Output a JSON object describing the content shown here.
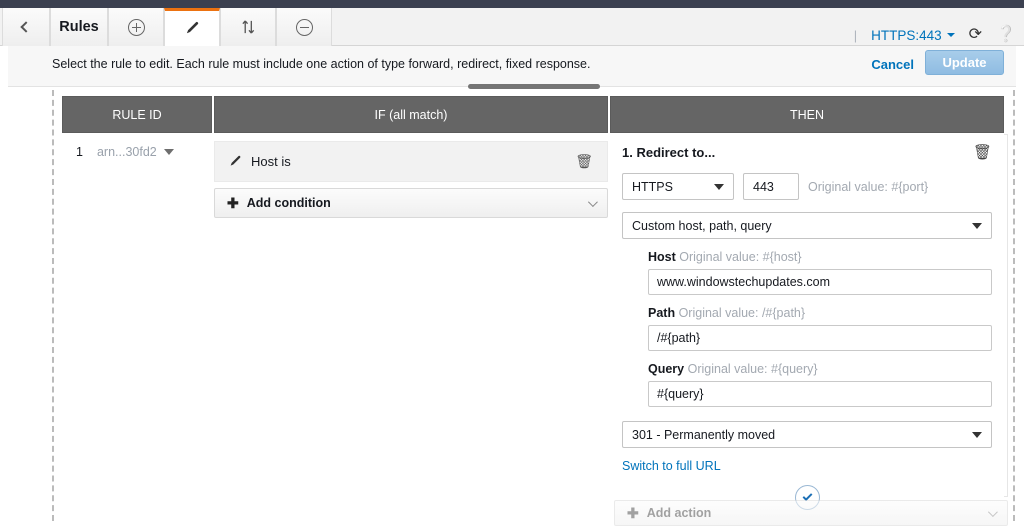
{
  "toolbar": {
    "back_icon": "chevron-left-icon",
    "title": "Rules",
    "add_icon": "plus-circle-icon",
    "edit_icon": "pencil-icon",
    "reorder_icon": "sort-updown-icon",
    "delete_icon": "minus-circle-icon",
    "separator": "|",
    "listener": "HTTPS:443",
    "refresh_icon": "refresh-icon",
    "help_icon": "help-circle-icon",
    "accent_color": "#ec7211"
  },
  "instruction_bar": {
    "text": "Select the rule to edit. Each rule must include one action of type forward, redirect, fixed response.",
    "cancel_label": "Cancel",
    "update_label": "Update",
    "link_color": "#0073bb",
    "update_bg": "#8fbce2"
  },
  "table": {
    "headers": {
      "rule_id": "RULE ID",
      "if": "IF (all match)",
      "then": "THEN"
    },
    "header_bg": "#656565",
    "rows": [
      {
        "number": "1",
        "arn": "arn...30fd2",
        "conditions": [
          {
            "icon": "pencil-icon",
            "label": "Host is",
            "delete_icon": "trash-icon"
          }
        ],
        "add_condition_label": "Add condition",
        "action": {
          "title": "1. Redirect to...",
          "delete_icon": "trash-icon",
          "protocol": "HTTPS",
          "port": "443",
          "port_note": "Original value: #{port}",
          "uri_mode": "Custom host, path, query",
          "fields": [
            {
              "label": "Host",
              "note": "Original value: #{host}",
              "value": "www.windowstechupdates.com"
            },
            {
              "label": "Path",
              "note": "Original value: /#{path}",
              "value": "/#{path}"
            },
            {
              "label": "Query",
              "note": "Original value: #{query}",
              "value": "#{query}"
            }
          ],
          "status_code": "301 - Permanently moved",
          "switch_link": "Switch to full URL",
          "confirm_icon": "check-circle-icon"
        },
        "add_action_label": "Add action"
      }
    ]
  }
}
